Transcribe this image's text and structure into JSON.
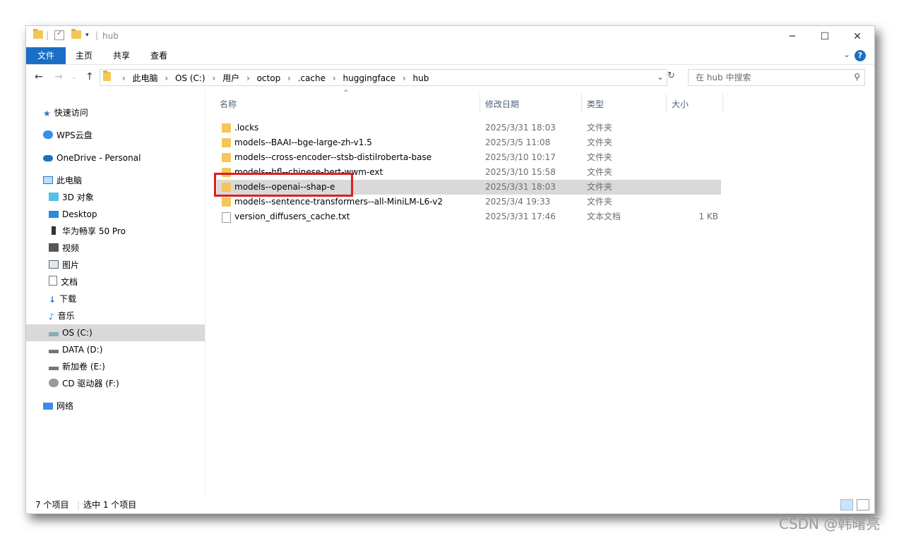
{
  "window": {
    "title": "hub"
  },
  "ribbon": {
    "tabs": [
      "文件",
      "主页",
      "共享",
      "查看"
    ],
    "help": "?"
  },
  "nav": {
    "back": "←",
    "forward": "→",
    "up": "↑"
  },
  "address": {
    "crumbs": [
      "此电脑",
      "OS (C:)",
      "用户",
      "octop",
      ".cache",
      "huggingface",
      "hub"
    ]
  },
  "search": {
    "placeholder": "在 hub 中搜索"
  },
  "sidebar": {
    "items": [
      {
        "label": "快速访问"
      },
      {
        "label": "WPS云盘"
      },
      {
        "label": "OneDrive - Personal"
      },
      {
        "label": "此电脑"
      },
      {
        "label": "3D 对象"
      },
      {
        "label": "Desktop"
      },
      {
        "label": "华为畅享 50 Pro"
      },
      {
        "label": "视频"
      },
      {
        "label": "图片"
      },
      {
        "label": "文档"
      },
      {
        "label": "下载"
      },
      {
        "label": "音乐"
      },
      {
        "label": "OS (C:)"
      },
      {
        "label": "DATA (D:)"
      },
      {
        "label": "新加卷 (E:)"
      },
      {
        "label": "CD 驱动器 (F:)"
      },
      {
        "label": "网络"
      }
    ]
  },
  "columns": {
    "name": "名称",
    "date": "修改日期",
    "type": "类型",
    "size": "大小"
  },
  "files": [
    {
      "name": ".locks",
      "date": "2025/3/31 18:03",
      "type": "文件夹",
      "size": ""
    },
    {
      "name": "models--BAAI--bge-large-zh-v1.5",
      "date": "2025/3/5 11:08",
      "type": "文件夹",
      "size": ""
    },
    {
      "name": "models--cross-encoder--stsb-distilroberta-base",
      "date": "2025/3/10 10:17",
      "type": "文件夹",
      "size": ""
    },
    {
      "name": "models--hfl--chinese-bert-wwm-ext",
      "date": "2025/3/10 15:58",
      "type": "文件夹",
      "size": ""
    },
    {
      "name": "models--openai--shap-e",
      "date": "2025/3/31 18:03",
      "type": "文件夹",
      "size": ""
    },
    {
      "name": "models--sentence-transformers--all-MiniLM-L6-v2",
      "date": "2025/3/4 19:33",
      "type": "文件夹",
      "size": ""
    },
    {
      "name": "version_diffusers_cache.txt",
      "date": "2025/3/31 17:46",
      "type": "文本文档",
      "size": "1 KB"
    }
  ],
  "status": {
    "count": "7 个项目",
    "selected": "选中 1 个项目"
  },
  "watermark": "CSDN @韩曙亮"
}
